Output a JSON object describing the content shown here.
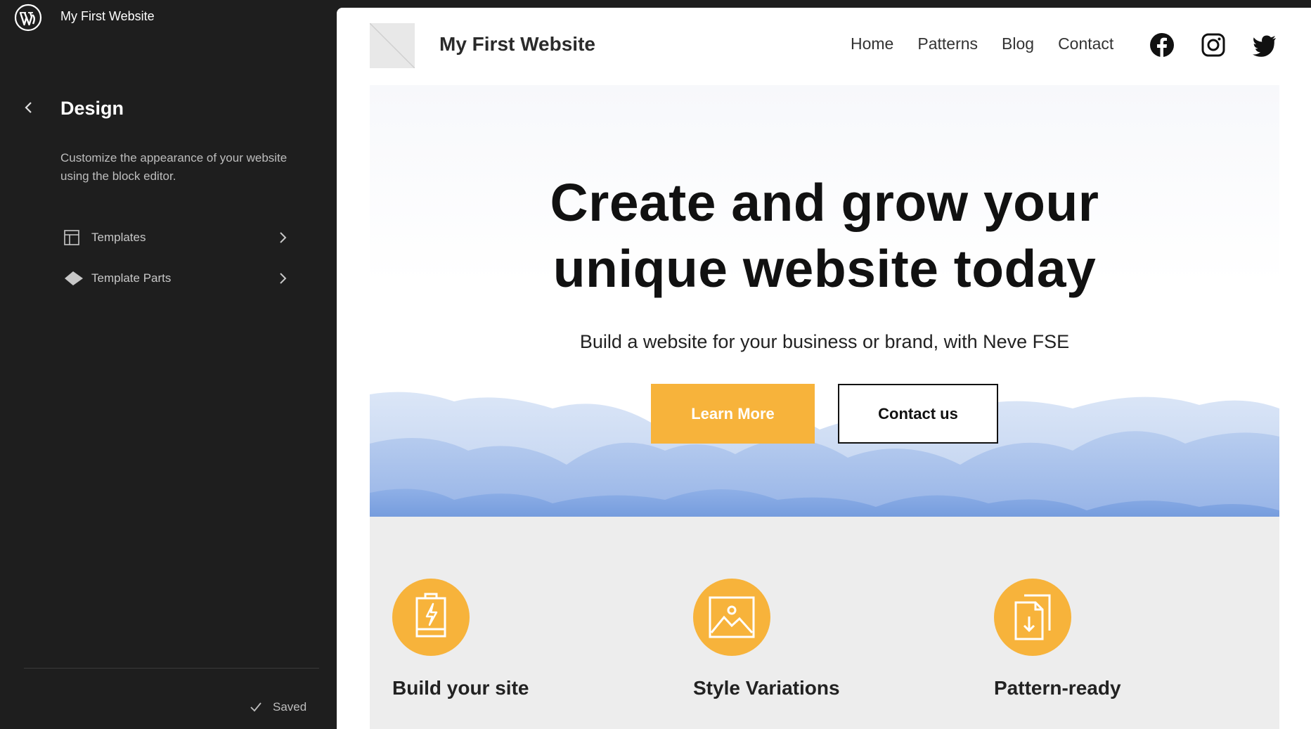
{
  "sidebar": {
    "site_name": "My First Website",
    "section_title": "Design",
    "description": "Customize the appearance of your website using the block editor.",
    "items": [
      {
        "label": "Templates",
        "icon": "layout-icon"
      },
      {
        "label": "Template Parts",
        "icon": "diamond-icon"
      }
    ],
    "status": "Saved"
  },
  "preview": {
    "site_title": "My First Website",
    "menu": [
      "Home",
      "Patterns",
      "Blog",
      "Contact"
    ],
    "social": [
      "facebook-icon",
      "instagram-icon",
      "twitter-icon"
    ],
    "hero": {
      "title_line1": "Create and grow your",
      "title_line2": "unique website today",
      "subtitle": "Build a website for your business or brand, with Neve FSE",
      "primary_button": "Learn More",
      "secondary_button": "Contact us"
    },
    "features": [
      {
        "label": "Build your site",
        "icon": "battery-bolt-icon"
      },
      {
        "label": "Style Variations",
        "icon": "image-icon"
      },
      {
        "label": "Pattern-ready",
        "icon": "file-download-icon"
      }
    ]
  },
  "colors": {
    "sidebar_bg": "#1e1e1e",
    "accent": "#f7b33b",
    "features_bg": "#ededed",
    "mountain_blue": "#7ea3dc"
  }
}
